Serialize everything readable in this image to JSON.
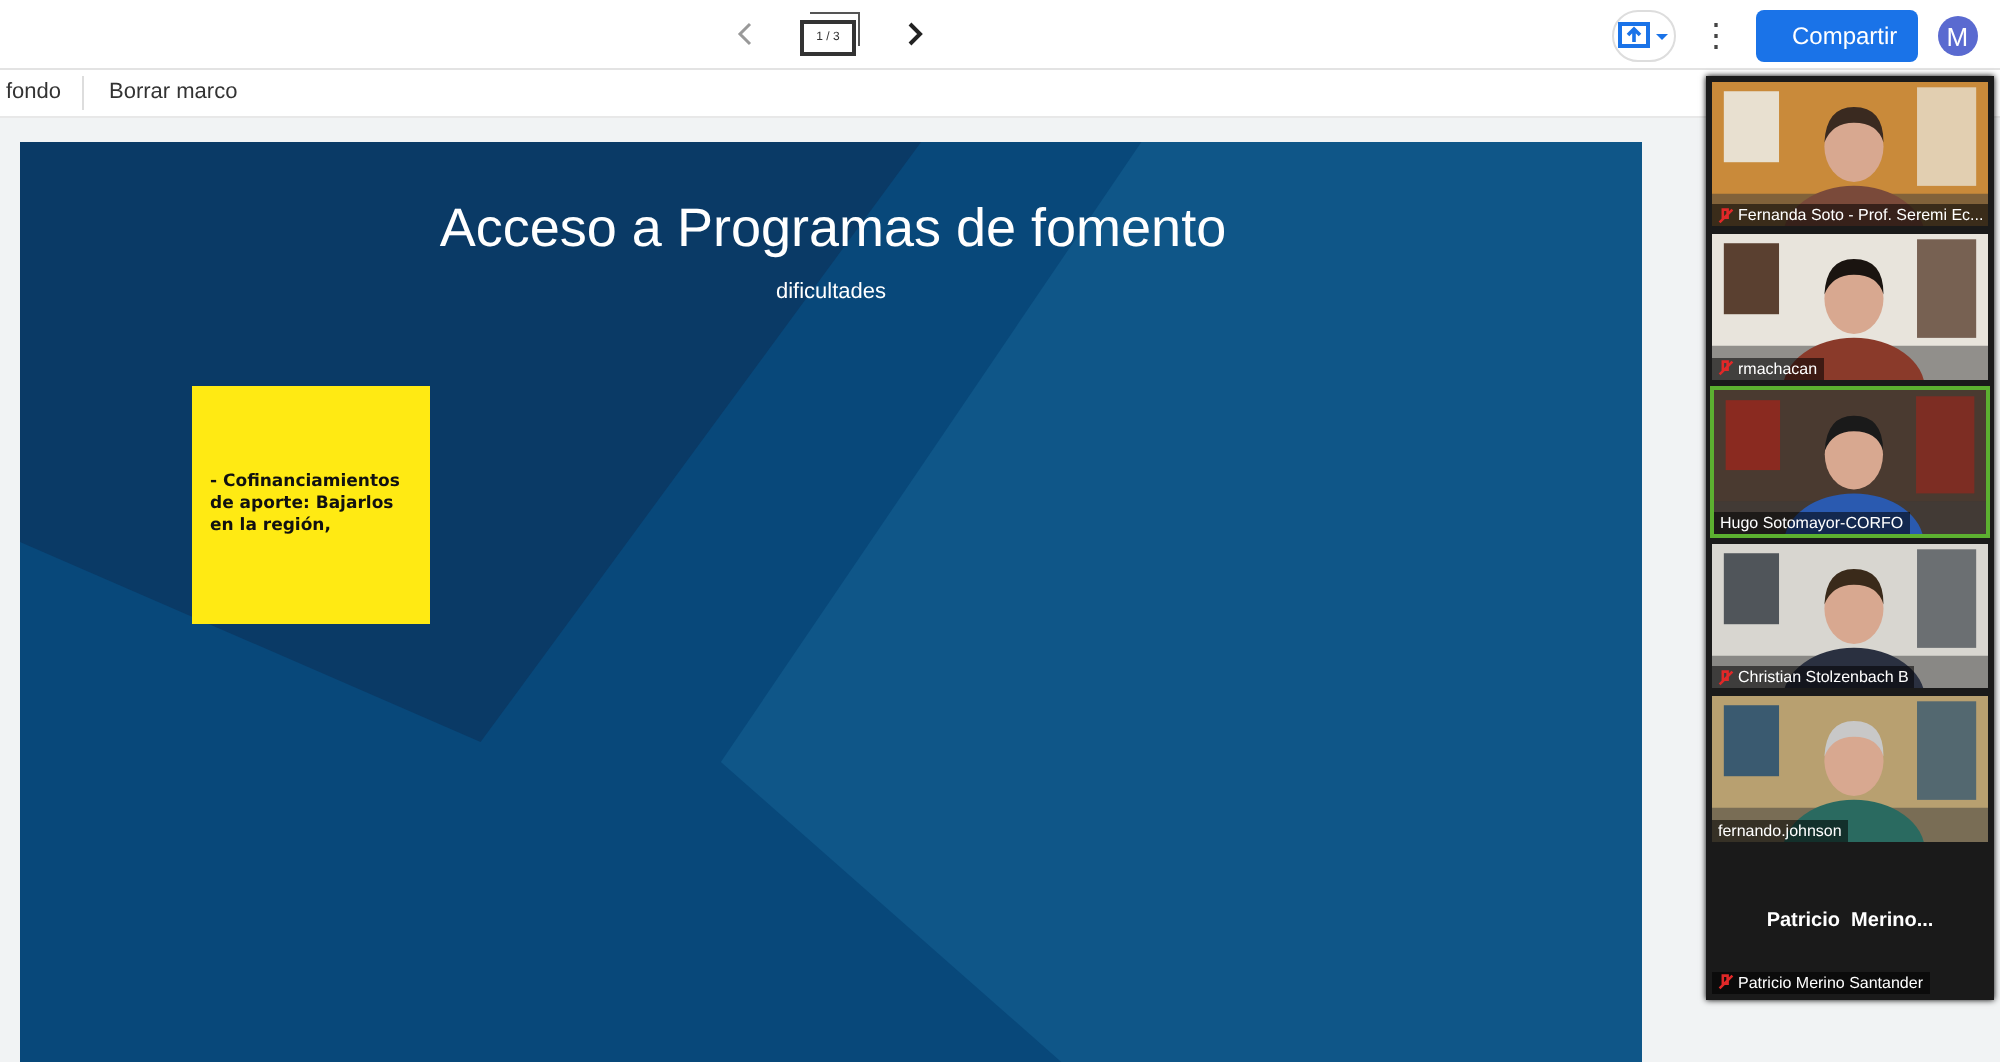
{
  "topbar": {
    "page_indicator": "1 / 3",
    "share_label": "Compartir",
    "avatar_letter": "M",
    "menu_glyph": "⋮"
  },
  "toolbar": {
    "items": [
      "fondo",
      "Borrar marco"
    ]
  },
  "slide": {
    "title": "Acceso a Programas de fomento",
    "subtitle": "dificultades",
    "notes": [
      {
        "text": "- Cofinanciamientos de aporte: Bajarlos en la región,",
        "color": "#ffea13"
      }
    ]
  },
  "participants": [
    {
      "name": "Fernanda Soto - Prof. Seremi Ec...",
      "kind": "video",
      "muted": true,
      "selected": false
    },
    {
      "name": "rmachacan",
      "kind": "video",
      "muted": true,
      "selected": false
    },
    {
      "name": "Hugo Sotomayor-CORFO",
      "kind": "video",
      "muted": false,
      "selected": true
    },
    {
      "name": "Christian Stolzenbach B",
      "kind": "video",
      "muted": true,
      "selected": false
    },
    {
      "name": "fernando.johnson",
      "kind": "video",
      "muted": false,
      "selected": false
    },
    {
      "name": "Patricio Merino Santander",
      "kind": "no_video",
      "display_name": "Patricio  Merino...",
      "muted": true,
      "selected": false
    }
  ]
}
